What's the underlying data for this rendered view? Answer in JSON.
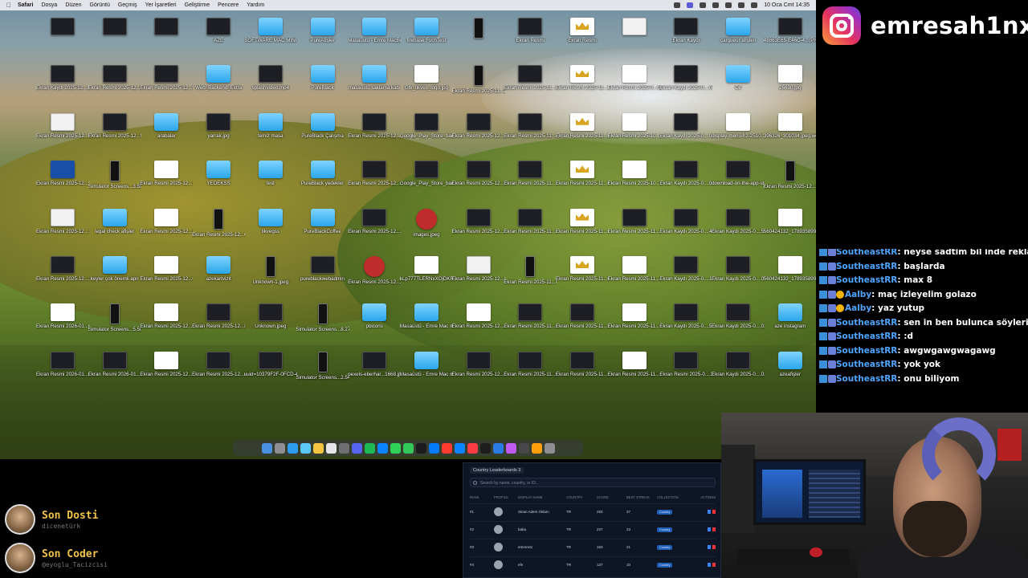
{
  "menubar": {
    "apple": "",
    "items": [
      "Safari",
      "Dosya",
      "Düzen",
      "Görüntü",
      "Geçmiş",
      "Yer İşaretleri",
      "Geliştirme",
      "Pencere",
      "Yardım"
    ],
    "clock": "10 Oca Cmt 14:35"
  },
  "desktop_icons": [
    {
      "label": "",
      "type": "dark"
    },
    {
      "label": "",
      "type": "dark"
    },
    {
      "label": "",
      "type": "dark"
    },
    {
      "label": "AZE",
      "type": "dark"
    },
    {
      "label": "SOFTWARE MAC MINI",
      "type": "folder"
    },
    {
      "label": "PureAfişler",
      "type": "folder"
    },
    {
      "label": "Masaüstü - Emre MacBook Air",
      "type": "folder"
    },
    {
      "label": "firebase FuchTest",
      "type": "folder"
    },
    {
      "label": "",
      "type": "phone"
    },
    {
      "label": "Ekran Resmi",
      "type": "dark"
    },
    {
      "label": "Ekran Resmi",
      "type": "crown"
    },
    {
      "label": "",
      "type": "light"
    },
    {
      "label": "Ekran Kaydı",
      "type": "dark"
    },
    {
      "label": "cargueur afişleri",
      "type": "folder"
    },
    {
      "label": "48863E65-E46C-4...(PNG)",
      "type": "dark"
    },
    {
      "label": "Ekran Kaydı 2025-12...17.25.27",
      "type": "dark"
    },
    {
      "label": "Ekran Resmi 2025-12...9.03 (2)",
      "type": "dark"
    },
    {
      "label": "Ekran Resmi 2025-12...5.32 (3)",
      "type": "dark"
    },
    {
      "label": "Web_Backend_Extra",
      "type": "folder"
    },
    {
      "label": "splashvideo.mp4",
      "type": "dark"
    },
    {
      "label": "PureBlack",
      "type": "folder"
    },
    {
      "label": "masaüstü saklama kabı",
      "type": "folder"
    },
    {
      "label": "Gfk_tikves_logo.jpg",
      "type": "white"
    },
    {
      "label": "Ekran Resmi 2025-11...23.19.21",
      "type": "phone"
    },
    {
      "label": "Ekran Resmi 2025-11...02.47.02",
      "type": "dark"
    },
    {
      "label": "Ekran Resmi 2025-11...00.13.34",
      "type": "crown"
    },
    {
      "label": "Ekran Resmi 2025-0...02.11",
      "type": "white"
    },
    {
      "label": "Ekran Kaydı 2025-0....04.59",
      "type": "dark"
    },
    {
      "label": "Dif",
      "type": "folder"
    },
    {
      "label": "26690.jpg",
      "type": "white"
    },
    {
      "label": "Ekran Resmi 2025-12...19.55.53",
      "type": "light"
    },
    {
      "label": "Ekran Resmi 2025-12...9.03 (3)",
      "type": "dark"
    },
    {
      "label": "arabalar",
      "type": "folder"
    },
    {
      "label": "yarrak.jpg",
      "type": "dark"
    },
    {
      "label": "temiz masa",
      "type": "folder"
    },
    {
      "label": "PureBlack Çalışma",
      "type": "folder"
    },
    {
      "label": "Ekran Resmi 2025-12...16.21.41",
      "type": "dark"
    },
    {
      "label": "Google_Play_Store_badge_EN.svg",
      "type": "dark"
    },
    {
      "label": "Ekran Resmi 2025-12...21.08.21",
      "type": "dark"
    },
    {
      "label": "Ekran Resmi 2025-11...47.02 (2)",
      "type": "dark"
    },
    {
      "label": "Ekran Resmi 2025-11...00.13.40",
      "type": "crown"
    },
    {
      "label": "Ekran Resmi 2025-10...3.22.32",
      "type": "white"
    },
    {
      "label": "Ekran Kaydı 2025-0....08.49",
      "type": "dark"
    },
    {
      "label": "display-menu-h2-2510...1152.jpg",
      "type": "white"
    },
    {
      "label": "396326_301034.jpeg.webp",
      "type": "white"
    },
    {
      "label": "Ekran Resmi 2025-12...5.36 (2)",
      "type": "blue"
    },
    {
      "label": "Simulator Screens...3.59.png",
      "type": "phone"
    },
    {
      "label": "Ekran Resmi 2025-12...17.31.20",
      "type": "white"
    },
    {
      "label": "YEDEKSS",
      "type": "folder"
    },
    {
      "label": "test",
      "type": "folder"
    },
    {
      "label": "PureBlack yedekler",
      "type": "folder"
    },
    {
      "label": "Ekran Resmi 2025-12...21.41 (2)",
      "type": "dark"
    },
    {
      "label": "Google_Play_Store_badge_...svg.png",
      "type": "dark"
    },
    {
      "label": "Ekran Resmi 2025-12...07.41.20",
      "type": "dark"
    },
    {
      "label": "Ekran Resmi 2025-11...47.02 (3)",
      "type": "dark"
    },
    {
      "label": "Ekran Resmi 2025-11...00.13.46",
      "type": "crown"
    },
    {
      "label": "Ekran Resmi 2025-10...01.06.05",
      "type": "white"
    },
    {
      "label": "Ekran Kaydı 2025-0....09.51",
      "type": "dark"
    },
    {
      "label": "download-on-the-app-store.svg",
      "type": "dark"
    },
    {
      "label": "Ekran Resmi 2025-12...15.24.30",
      "type": "phone"
    },
    {
      "label": "Ekran Resmi 2025-12...17.16.37",
      "type": "light"
    },
    {
      "label": "legal check afişler",
      "type": "folder"
    },
    {
      "label": "Ekran Resmi 2025-12...17.32.35",
      "type": "white"
    },
    {
      "label": "Ekran Resmi 2025-12...08.40.16",
      "type": "phone"
    },
    {
      "label": "tikvegss",
      "type": "folder"
    },
    {
      "label": "PureBlackCoffee",
      "type": "folder"
    },
    {
      "label": "Ekran Resmi 2025-12...21.41 (3)",
      "type": "dark"
    },
    {
      "label": "images.jpeg",
      "type": "red"
    },
    {
      "label": "Ekran Resmi 2025-12...07.41.40",
      "type": "dark"
    },
    {
      "label": "Ekran Resmi 2025-11...01.29.41",
      "type": "dark"
    },
    {
      "label": "Ekran Resmi 2025-11...00.13.50",
      "type": "crown"
    },
    {
      "label": "Ekran Resmi 2025-11...22.23.03",
      "type": "dark"
    },
    {
      "label": "Ekran Kaydı 2025-0....46.07",
      "type": "dark"
    },
    {
      "label": "Ekran Kaydı 2025-0....59.45",
      "type": "dark"
    },
    {
      "label": "560424132_17893589952...8_n-1.jpg",
      "type": "white"
    },
    {
      "label": "Ekran Resmi 2025-12...21.25.38",
      "type": "dark"
    },
    {
      "label": "keyler çok önemli apn",
      "type": "folder"
    },
    {
      "label": "Ekran Resmi 2025-12...0.28.32",
      "type": "white"
    },
    {
      "label": "azekartvizit",
      "type": "folder"
    },
    {
      "label": "Unknown-1.jpeg",
      "type": "phone"
    },
    {
      "label": "pureblackwebadmin",
      "type": "dark"
    },
    {
      "label": "Ekran Resmi 2025-12...22.03.51",
      "type": "red"
    },
    {
      "label": "kLp777TLERNxXOjDKR0G6d...jpeg.avif",
      "type": "white"
    },
    {
      "label": "Ekran Resmi 2025-12...06.15.57",
      "type": "light"
    },
    {
      "label": "Ekran Resmi 2025-11...04.33.40",
      "type": "phone"
    },
    {
      "label": "Ekran Resmi 2025-11...00.13.55",
      "type": "crown"
    },
    {
      "label": "Ekran Resmi 2025-11...23.39.42",
      "type": "white"
    },
    {
      "label": "Ekran Kaydı 2025-0....11.25",
      "type": "dark"
    },
    {
      "label": "Ekran Kaydı 2025-0....01.44",
      "type": "dark"
    },
    {
      "label": "560424132_17893589952...65_n.jpg",
      "type": "white"
    },
    {
      "label": "Ekran Resmi 2026-01...02.57.19",
      "type": "white"
    },
    {
      "label": "Simulator Screens...5.50.png",
      "type": "phone"
    },
    {
      "label": "Ekran Resmi 2025-12...11.56.21",
      "type": "white"
    },
    {
      "label": "Ekran Resmi 2025-12...8.28.00",
      "type": "dark"
    },
    {
      "label": "Unknown.jpeg",
      "type": "dark"
    },
    {
      "label": "Simulator Screens...8.27.png",
      "type": "phone"
    },
    {
      "label": "pbicons",
      "type": "folder"
    },
    {
      "label": "Masaüstü - Emre Mac mini",
      "type": "folder"
    },
    {
      "label": "Ekran Resmi 2025-12...06.19.44",
      "type": "white"
    },
    {
      "label": "Ekran Resmi 2025-11...05.47.41",
      "type": "dark"
    },
    {
      "label": "Ekran Resmi 2025-11...21.18.42",
      "type": "dark"
    },
    {
      "label": "Ekran Resmi 2025-11...00.39.38",
      "type": "white"
    },
    {
      "label": "Ekran Kaydı 2025-0....59.07",
      "type": "dark"
    },
    {
      "label": "Ekran Kaydı 2025-0....02.16",
      "type": "dark"
    },
    {
      "label": "aze instagram",
      "type": "folder"
    },
    {
      "label": "Ekran Resmi 2026-01...02.32.13",
      "type": "dark"
    },
    {
      "label": "Ekran Resmi 2026-01...2.38.39",
      "type": "dark"
    },
    {
      "label": "Ekran Resmi 2025-12...11.56.55",
      "type": "white"
    },
    {
      "label": "Ekran Resmi 2025-12...8.35.32",
      "type": "dark"
    },
    {
      "label": "uuid=10379F2F-0FCD-49...true.png",
      "type": "dark"
    },
    {
      "label": "Simulator Screens...2.54.png",
      "type": "phone"
    },
    {
      "label": "pexels-eberhar...1668.jpg",
      "type": "dark"
    },
    {
      "label": "Masaüstü - Emre Mac mini - 1",
      "type": "folder"
    },
    {
      "label": "Ekran Resmi 2025-12...06.34.31",
      "type": "dark"
    },
    {
      "label": "Ekran Resmi 2025-11...08.23.27",
      "type": "dark"
    },
    {
      "label": "Ekran Resmi 2025-11...18.42 (2)",
      "type": "dark"
    },
    {
      "label": "Ekran Resmi 2025-11...00.12.28",
      "type": "white"
    },
    {
      "label": "Ekran Resmi 2025-0....35.26",
      "type": "dark"
    },
    {
      "label": "Ekran Kaydı 2025-0....02.25",
      "type": "dark"
    },
    {
      "label": "azeafişler",
      "type": "folder"
    }
  ],
  "dock_colors": [
    "#4a90e2",
    "#8e8e93",
    "#2d9bf0",
    "#5ac8fa",
    "#f5c542",
    "#e5e5ea",
    "#6e6e73",
    "#5865f2",
    "#1db954",
    "#0a84ff",
    "#30d158",
    "#34c759",
    "#1c1c1e",
    "#007aff",
    "#ff3b30",
    "#0a84ff",
    "#fc3c44",
    "#1e1e1e",
    "#2c7be5",
    "#bf5af2",
    "#48484a",
    "#ff9f0a",
    "#8e8e93"
  ],
  "instagram": {
    "handle": "emresah1nx"
  },
  "chat": [
    {
      "user": "SoutheastRR",
      "text": "neyse sadtim bil inde reklam izliye izliye sonsuz can yapam",
      "gold": false,
      "partial": true
    },
    {
      "user": "SoutheastRR",
      "text": "başlarda",
      "gold": false
    },
    {
      "user": "SoutheastRR",
      "text": "max 8",
      "gold": false
    },
    {
      "user": "Aalby",
      "text": "maç izleyelim golazo",
      "gold": true
    },
    {
      "user": "Aalby",
      "text": "yaz yutup",
      "gold": true
    },
    {
      "user": "SoutheastRR",
      "text": "sen in ben bulunca söylerim",
      "gold": false
    },
    {
      "user": "SoutheastRR",
      "text": ":d",
      "gold": false
    },
    {
      "user": "SoutheastRR",
      "text": "awgwgawgwagawg",
      "gold": false
    },
    {
      "user": "SoutheastRR",
      "text": "yok yok",
      "gold": false
    },
    {
      "user": "SoutheastRR",
      "text": "onu biliyom",
      "gold": false
    }
  ],
  "donation": {
    "title": "Son Dosti",
    "name": "dicenetürk"
  },
  "coder": {
    "title": "Son Coder",
    "name": "@eyoglu_Tacizcisi"
  },
  "leaderboard": {
    "tab": "Country Leaderboards",
    "tab_count": "3",
    "search_placeholder": "Search by name, country, or ID...",
    "headers": [
      "RANK",
      "PROFILE",
      "DISPLAY NAME",
      "COUNTRY",
      "SCORE",
      "BEST STREAK",
      "COLLECTION",
      "ACTIONS"
    ],
    "rows": [
      {
        "rank": "#1",
        "name": "Sinan Adem Oldum",
        "country": "TR",
        "score": "283",
        "streak": "37",
        "collection": "Country"
      },
      {
        "rank": "#2",
        "name": "baba",
        "country": "TR",
        "score": "227",
        "streak": "23",
        "collection": "Country"
      },
      {
        "rank": "#3",
        "name": "emrerest",
        "country": "TR",
        "score": "153",
        "streak": "21",
        "collection": "Country"
      },
      {
        "rank": "#4",
        "name": "efe",
        "country": "TR",
        "score": "137",
        "streak": "10",
        "collection": "Country"
      }
    ]
  }
}
